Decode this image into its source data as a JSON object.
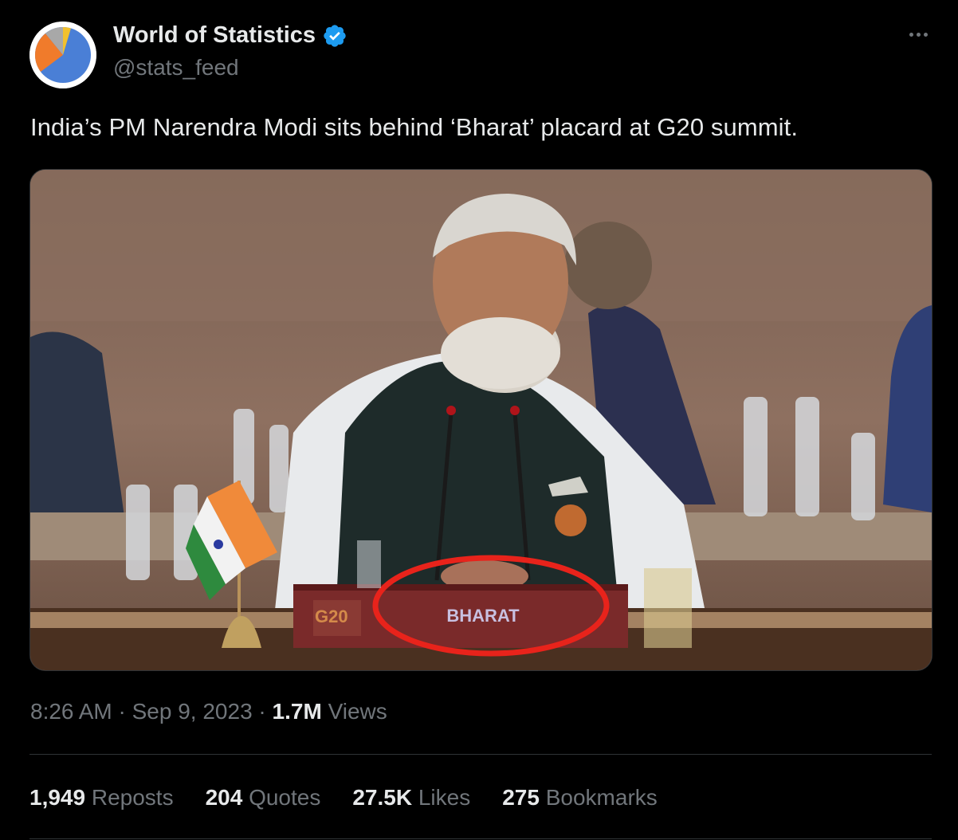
{
  "author": {
    "display_name": "World of Statistics",
    "handle": "@stats_feed",
    "avatar_icon": "pie-chart-avatar",
    "verified": true,
    "verified_color": "#1d9bf0"
  },
  "post": {
    "text": "India’s PM Narendra Modi sits behind ‘Bharat’ placard at G20 summit.",
    "media": {
      "placard_text": "BHARAT",
      "logo_text": "G20",
      "highlight_color": "#e8231b"
    },
    "time": "8:26 AM",
    "separator": " · ",
    "date": "Sep 9, 2023",
    "views_count": "1.7M",
    "views_label": " Views"
  },
  "stats": [
    {
      "count": "1,949",
      "label": " Reposts"
    },
    {
      "count": "204",
      "label": " Quotes"
    },
    {
      "count": "27.5K",
      "label": " Likes"
    },
    {
      "count": "275",
      "label": " Bookmarks"
    }
  ],
  "menu_icon": "more-horizontal-icon"
}
